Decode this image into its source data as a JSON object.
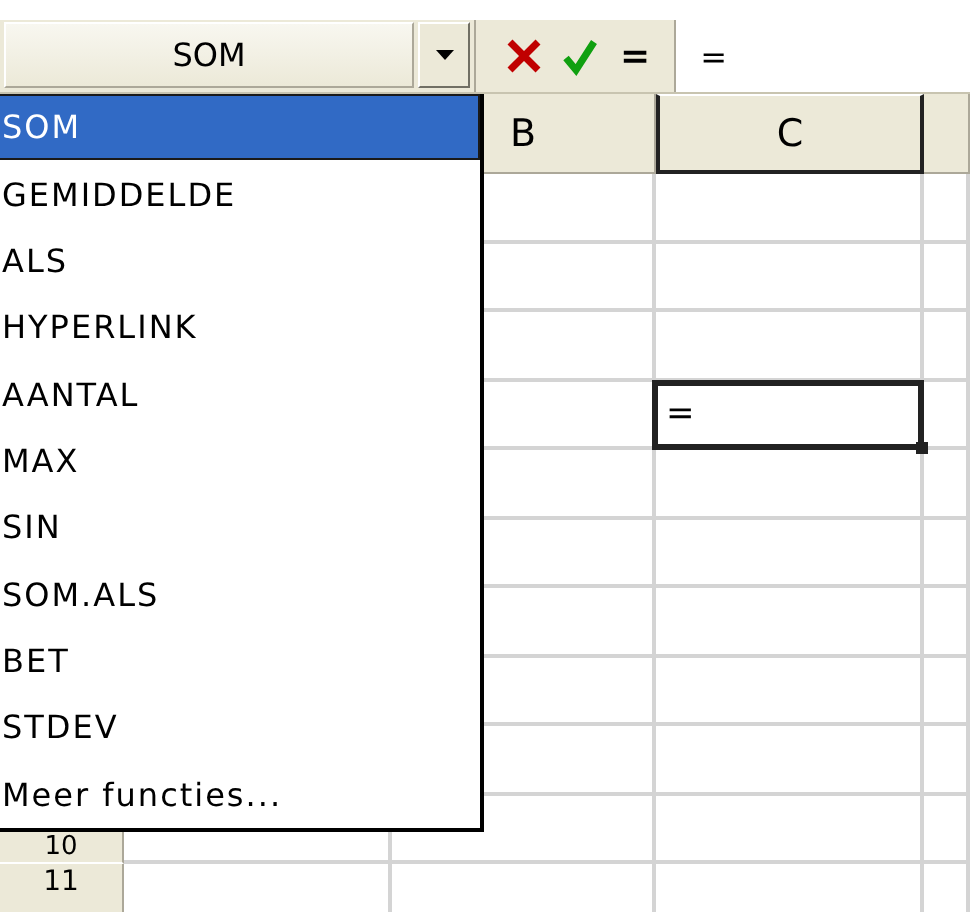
{
  "name_box": {
    "value": "SOM"
  },
  "formula_bar": {
    "function_button": {
      "label": "="
    },
    "value": "="
  },
  "columns": [
    {
      "label": "B",
      "selected": false
    },
    {
      "label": "C",
      "selected": true
    }
  ],
  "row_headers": [
    {
      "label": "10"
    },
    {
      "label": "11"
    }
  ],
  "active_cell": {
    "value": "="
  },
  "function_list": [
    {
      "label": "SOM",
      "selected": true
    },
    {
      "label": "GEMIDDELDE",
      "selected": false
    },
    {
      "label": "ALS",
      "selected": false
    },
    {
      "label": "HYPERLINK",
      "selected": false
    },
    {
      "label": "AANTAL",
      "selected": false
    },
    {
      "label": "MAX",
      "selected": false
    },
    {
      "label": "SIN",
      "selected": false
    },
    {
      "label": "SOM.ALS",
      "selected": false
    },
    {
      "label": "BET",
      "selected": false
    },
    {
      "label": "STDEV",
      "selected": false
    },
    {
      "label": "Meer functies...",
      "selected": false
    }
  ]
}
